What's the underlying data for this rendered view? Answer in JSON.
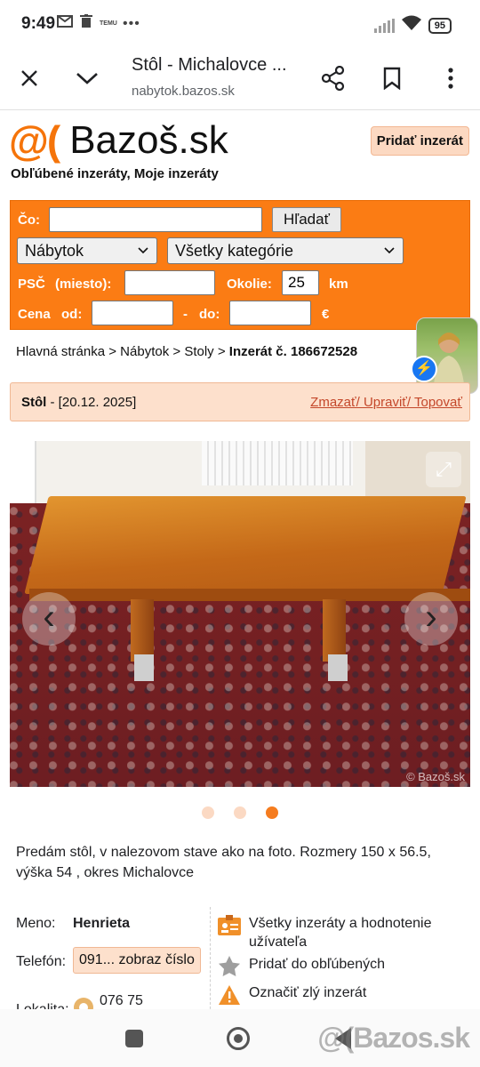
{
  "status_bar": {
    "time": "9:49",
    "notification_icons": [
      "gmail-icon",
      "trash-icon",
      "temu-icon",
      "more-dots-icon"
    ],
    "temu_label": "TEMU",
    "battery": "95"
  },
  "browser": {
    "tab_title": "Stôl - Michalovce ...",
    "domain": "nabytok.bazos.sk"
  },
  "site": {
    "logo_at": "@(",
    "logo_name": "Bazoš.sk",
    "add_button": "Pridať inzerát",
    "favorites_links": "Obľúbené inzeráty, Moje inzeráty"
  },
  "search": {
    "query_label": "Čo:",
    "query_value": "",
    "search_button": "Hľadať",
    "category_selected": "Nábytok",
    "subcategory_selected": "Všetky kategórie",
    "psc_label": "PSČ",
    "psc_sub_label": "(miesto):",
    "psc_value": "",
    "radius_label": "Okolie:",
    "radius_value": "25",
    "radius_unit": "km",
    "price_label": "Cena",
    "price_from_label": "od:",
    "price_dash": "-",
    "price_to_label": "do:",
    "price_from_value": "",
    "price_to_value": "",
    "currency": "€"
  },
  "breadcrumb": {
    "home": "Hlavná stránka",
    "sep": ">",
    "category": "Nábytok",
    "subcategory": "Stoly",
    "current": "Inzerát č. 186672528"
  },
  "ad": {
    "title": "Stôl",
    "date": "- [20.12. 2025]",
    "actions": "Zmazať/ Upraviť/ Topovať",
    "image_count": 3,
    "active_image": 3,
    "watermark": "© Bazoš.sk",
    "description": "Predám stôl, v nalezovom stave ako na foto. Rozmery 150 x 56.5, výška 54 , okres Michalovce"
  },
  "seller": {
    "name_label": "Meno:",
    "name_value": "Henrieta",
    "phone_label": "Telefón:",
    "phone_button": "091... zobraz číslo",
    "location_label": "Lokalita:",
    "location_value": "076 75"
  },
  "side_links": {
    "all_ads": "Všetky inzeráty a hodnotenie užívateľa",
    "add_favorite": "Pridať do obľúbených",
    "report": "Označiť zlý inzerát"
  },
  "footer_watermark": "@(Bazos.sk",
  "colors": {
    "brand_orange": "#fb7c14",
    "light_orange": "#fde0cc",
    "link_red": "#c4472a"
  }
}
